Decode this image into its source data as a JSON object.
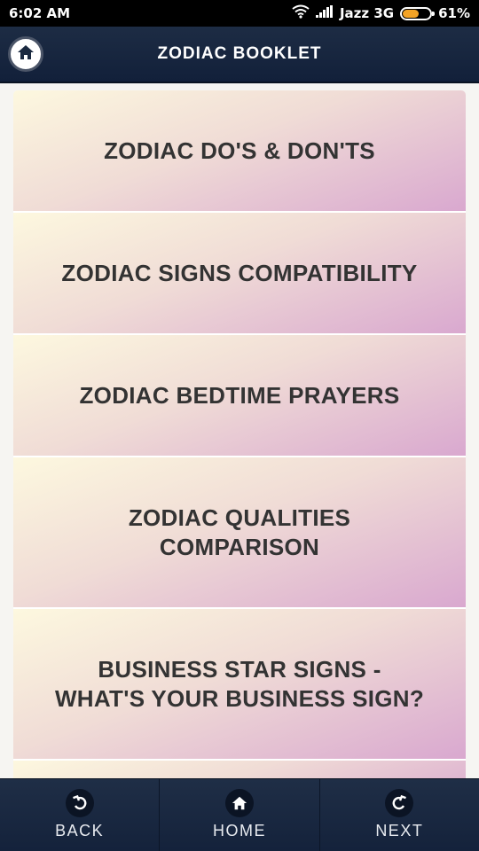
{
  "status_bar": {
    "time": "6:02 AM",
    "carrier": "Jazz 3G",
    "battery": "61%",
    "battery_level": 0.61,
    "icons": [
      "wifi-icon",
      "signal-icon",
      "battery-icon"
    ]
  },
  "header": {
    "title": "ZODIAC BOOKLET",
    "home_icon": "home-icon"
  },
  "menu": {
    "items": [
      {
        "lines": [
          "ZODIAC DO'S & DON'TS"
        ]
      },
      {
        "lines": [
          "ZODIAC SIGNS COMPATIBILITY"
        ]
      },
      {
        "lines": [
          "ZODIAC BEDTIME PRAYERS"
        ]
      },
      {
        "lines": [
          "ZODIAC QUALITIES",
          "COMPARISON"
        ]
      },
      {
        "lines": [
          "BUSINESS STAR SIGNS -",
          "WHAT'S YOUR BUSINESS SIGN?"
        ]
      }
    ]
  },
  "bottom_nav": {
    "back_label": "BACK",
    "home_label": "HOME",
    "next_label": "NEXT"
  },
  "colors": {
    "header_bg": "#1a2940",
    "item_gradient_start": "#fdf8df",
    "item_gradient_end": "#d9a8cf",
    "battery_accent": "#f3a326"
  }
}
